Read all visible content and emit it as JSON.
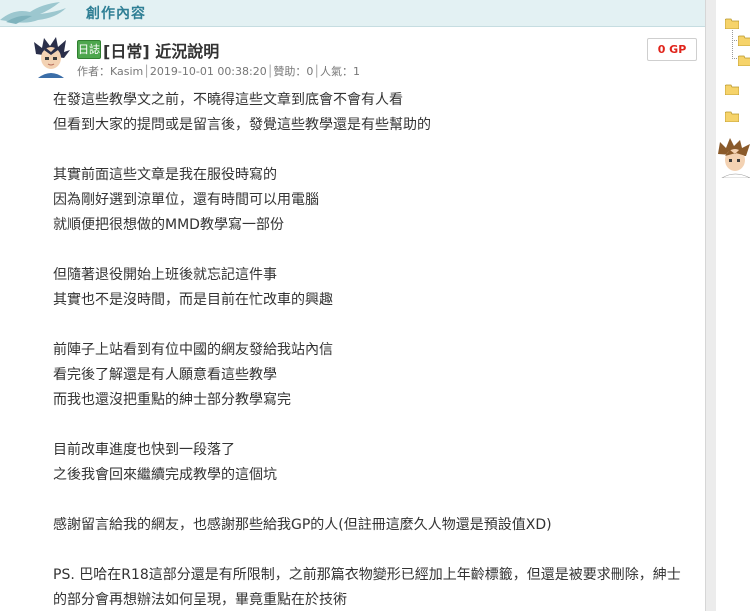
{
  "header": {
    "title": "創作內容"
  },
  "post": {
    "badge": "日誌",
    "title": "[日常] 近況說明",
    "meta": {
      "author_label": "作者：",
      "author": "Kasim",
      "sep1": "│",
      "datetime": "2019-10-01 00:38:20",
      "sep2": "│",
      "donate": "贊助：0",
      "sep3": "│",
      "popularity": "人氣：1"
    },
    "gp": "0 GP",
    "paragraphs": [
      [
        "在發這些教學文之前，不曉得這些文章到底會不會有人看",
        "但看到大家的提問或是留言後，發覺這些教學還是有些幫助的"
      ],
      [
        "其實前面這些文章是我在服役時寫的",
        "因為剛好選到涼單位，還有時間可以用電腦",
        "就順便把很想做的MMD教學寫一部份"
      ],
      [
        "但隨著退役開始上班後就忘記這件事",
        "其實也不是沒時間，而是目前在忙改車的興趣"
      ],
      [
        "前陣子上站看到有位中國的網友發給我站內信",
        "看完後了解還是有人願意看這些教學",
        "而我也還沒把重點的紳士部分教學寫完"
      ],
      [
        "目前改車進度也快到一段落了",
        "之後我會回來繼續完成教學的這個坑"
      ],
      [
        "感謝留言給我的網友，也感謝那些給我GP的人(但註冊這麼久人物還是預設值XD)"
      ],
      [
        "PS. 巴哈在R18這部分還是有所限制，之前那篇衣物變形已經加上年齡標籤，但還是被要求刪除，紳士的部分會再想辦法如何呈現，畢竟重點在於技術"
      ]
    ]
  },
  "icons": {
    "header_logo": "dragon-wing-logo",
    "avatar": "user-avatar",
    "sidebar_folder": "folder-icon",
    "sidebar_avatar": "user-avatar"
  },
  "colors": {
    "header_bg": "#e3f1f3",
    "header_title": "#2f7f95",
    "badge_green": "#4da64d",
    "gp_red": "#e0241b",
    "text": "#333333"
  }
}
